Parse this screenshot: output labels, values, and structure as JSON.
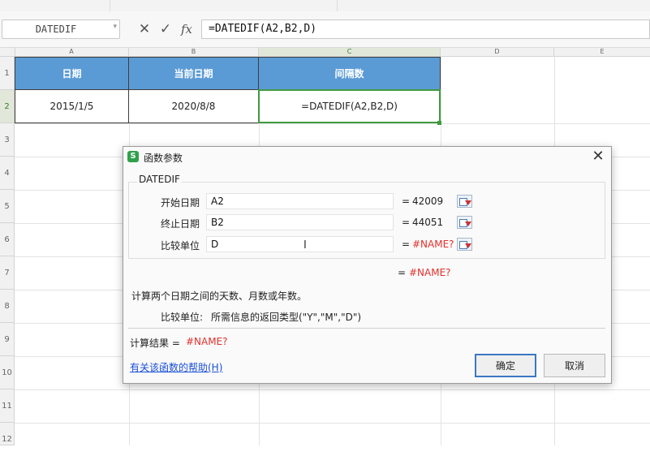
{
  "formula_bar": {
    "name_box": "DATEDIF",
    "cancel_icon": "x-icon",
    "confirm_icon": "check-icon",
    "fx_label": "fx",
    "formula": "=DATEDIF(A2,B2,D)"
  },
  "sheet": {
    "columns": [
      "A",
      "B",
      "C",
      "D",
      "E"
    ],
    "rows": [
      "1",
      "2",
      "3",
      "4",
      "5",
      "6",
      "7",
      "8",
      "9",
      "10",
      "11",
      "12"
    ],
    "header_row": [
      "日期",
      "当前日期",
      "间隔数"
    ],
    "data_row": [
      "2015/1/5",
      "2020/8/8",
      "=DATEDIF(A2,B2,D)"
    ]
  },
  "dialog": {
    "title": "函数参数",
    "function_name": "DATEDIF",
    "args": [
      {
        "label": "开始日期",
        "value": "A2",
        "eq": "=",
        "result": "42009"
      },
      {
        "label": "终止日期",
        "value": "B2",
        "eq": "=",
        "result": "44051"
      },
      {
        "label": "比较单位",
        "value": "D",
        "eq": "=",
        "result": "#NAME?"
      }
    ],
    "overall_eq": "=",
    "overall_result": "#NAME?",
    "description": "计算两个日期之间的天数、月数或年数。",
    "param_desc_label": "比较单位:",
    "param_desc_text": "所需信息的返回类型(\"Y\",\"M\",\"D\")",
    "calc_label": "计算结果 =",
    "calc_result": "#NAME?",
    "help_link": "有关该函数的帮助(H)",
    "ok_button": "确定",
    "cancel_button": "取消",
    "close_icon": "close-icon",
    "logo_icon": "wps-logo-icon",
    "logo_letter": "S"
  },
  "colors": {
    "header_fill": "#5b9bd5",
    "active_border": "#3f9a3f",
    "error_text": "#e0312c",
    "link_text": "#1a4fd6"
  }
}
